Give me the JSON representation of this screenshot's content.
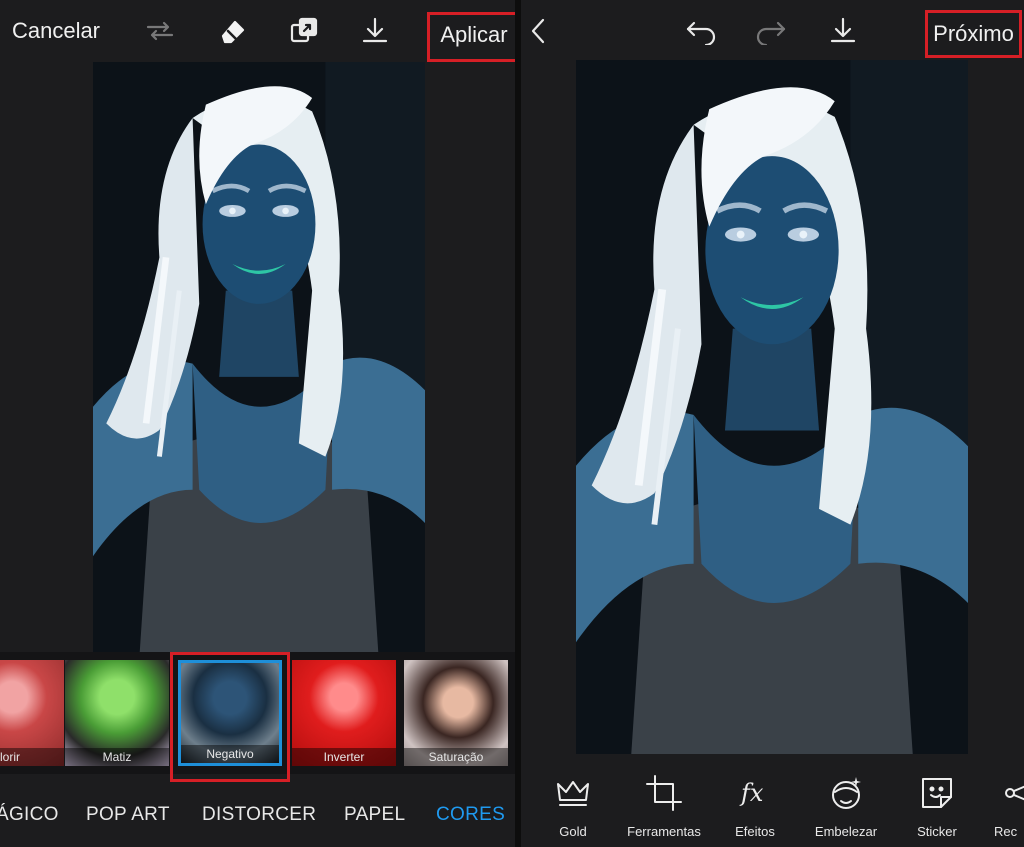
{
  "left": {
    "cancel_label": "Cancelar",
    "apply_label": "Aplicar",
    "filters": [
      {
        "label": "lorir"
      },
      {
        "label": "Matiz"
      },
      {
        "label": "Negativo",
        "selected": true
      },
      {
        "label": "Inverter"
      },
      {
        "label": "Saturação"
      }
    ],
    "categories": [
      {
        "label": "ÁGICO"
      },
      {
        "label": "POP ART"
      },
      {
        "label": "DISTORCER"
      },
      {
        "label": "PAPEL"
      },
      {
        "label": "CORES",
        "active": true
      }
    ]
  },
  "right": {
    "next_label": "Próximo",
    "tools": [
      {
        "label": "Gold",
        "icon": "crown-icon"
      },
      {
        "label": "Ferramentas",
        "icon": "crop-icon"
      },
      {
        "label": "Efeitos",
        "icon": "fx-icon"
      },
      {
        "label": "Embelezar",
        "icon": "face-sparkle-icon"
      },
      {
        "label": "Sticker",
        "icon": "sticker-icon"
      },
      {
        "label": "Rec",
        "icon": "scissors-icon"
      }
    ]
  },
  "colors": {
    "highlight": "#d61f26",
    "accent": "#1f9af0",
    "selected_border": "#1e8fd9"
  }
}
